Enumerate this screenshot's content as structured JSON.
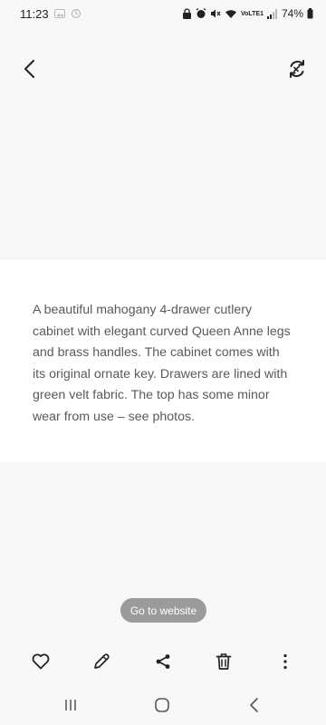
{
  "status_bar": {
    "time": "11:23",
    "network_label": "VoLTE1",
    "battery_percent": "74%"
  },
  "top_bar": {
    "back_icon": "chevron-left-icon",
    "convert_icon": "convert-refresh-icon"
  },
  "content": {
    "description": "A beautiful mahogany 4-drawer cutlery cabinet with elegant curved Queen Anne legs and brass handles. The cabinet comes with its original ornate key. Drawers are lined with green velt fabric. The top has some minor wear from use – see photos."
  },
  "actions": {
    "go_to_website": "Go to website"
  },
  "toolbar": {
    "icons": [
      "heart-icon",
      "pencil-icon",
      "share-icon",
      "trash-icon",
      "more-vertical-icon"
    ]
  },
  "nav": {
    "icons": [
      "recents-icon",
      "home-icon",
      "back-icon"
    ]
  },
  "colors": {
    "background": "#f8f8f8",
    "card": "#ffffff",
    "text": "#5a5a5a",
    "pill": "#9b9b9b"
  }
}
